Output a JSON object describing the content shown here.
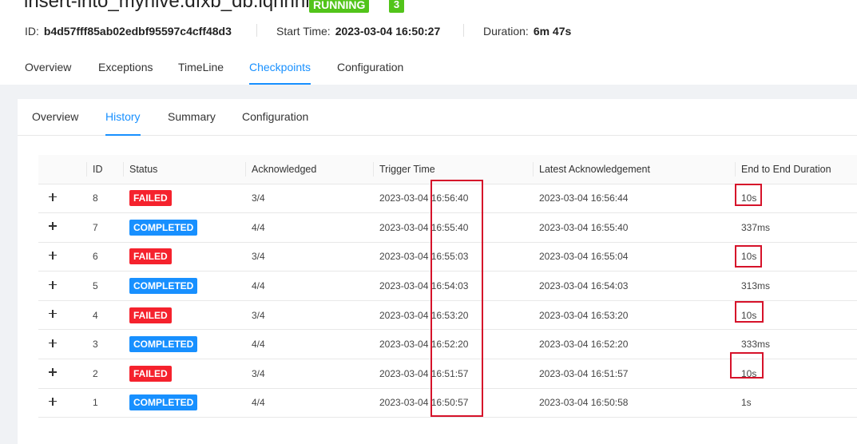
{
  "job": {
    "title": "insert-into_myhive.dfxb_db.lqhhhh",
    "state": "RUNNING",
    "count": "3",
    "id_label": "ID:",
    "id_value": "b4d57fff85ab02edbf95597c4cff48d3",
    "start_label": "Start Time:",
    "start_value": "2023-03-04 16:50:27",
    "duration_label": "Duration:",
    "duration_value": "6m 47s"
  },
  "tabs": [
    "Overview",
    "Exceptions",
    "TimeLine",
    "Checkpoints",
    "Configuration"
  ],
  "subtabs": [
    "Overview",
    "History",
    "Summary",
    "Configuration"
  ],
  "table": {
    "headers": [
      "ID",
      "Status",
      "Acknowledged",
      "Trigger Time",
      "Latest Acknowledgement",
      "End to End Duration"
    ],
    "rows": [
      {
        "id": "8",
        "status": "FAILED",
        "ack": "3/4",
        "trigger": "2023-03-04 16:56:40",
        "latest": "2023-03-04 16:56:44",
        "duration": "10s"
      },
      {
        "id": "7",
        "status": "COMPLETED",
        "ack": "4/4",
        "trigger": "2023-03-04 16:55:40",
        "latest": "2023-03-04 16:55:40",
        "duration": "337ms"
      },
      {
        "id": "6",
        "status": "FAILED",
        "ack": "3/4",
        "trigger": "2023-03-04 16:55:03",
        "latest": "2023-03-04 16:55:04",
        "duration": "10s"
      },
      {
        "id": "5",
        "status": "COMPLETED",
        "ack": "4/4",
        "trigger": "2023-03-04 16:54:03",
        "latest": "2023-03-04 16:54:03",
        "duration": "313ms"
      },
      {
        "id": "4",
        "status": "FAILED",
        "ack": "3/4",
        "trigger": "2023-03-04 16:53:20",
        "latest": "2023-03-04 16:53:20",
        "duration": "10s"
      },
      {
        "id": "3",
        "status": "COMPLETED",
        "ack": "4/4",
        "trigger": "2023-03-04 16:52:20",
        "latest": "2023-03-04 16:52:20",
        "duration": "333ms"
      },
      {
        "id": "2",
        "status": "FAILED",
        "ack": "3/4",
        "trigger": "2023-03-04 16:51:57",
        "latest": "2023-03-04 16:51:57",
        "duration": "10s"
      },
      {
        "id": "1",
        "status": "COMPLETED",
        "ack": "4/4",
        "trigger": "2023-03-04 16:50:57",
        "latest": "2023-03-04 16:50:58",
        "duration": "1s"
      }
    ]
  },
  "colors": {
    "accent": "#1890ff",
    "failed": "#f5222d",
    "running": "#52c41a",
    "highlight": "#d6122a"
  }
}
